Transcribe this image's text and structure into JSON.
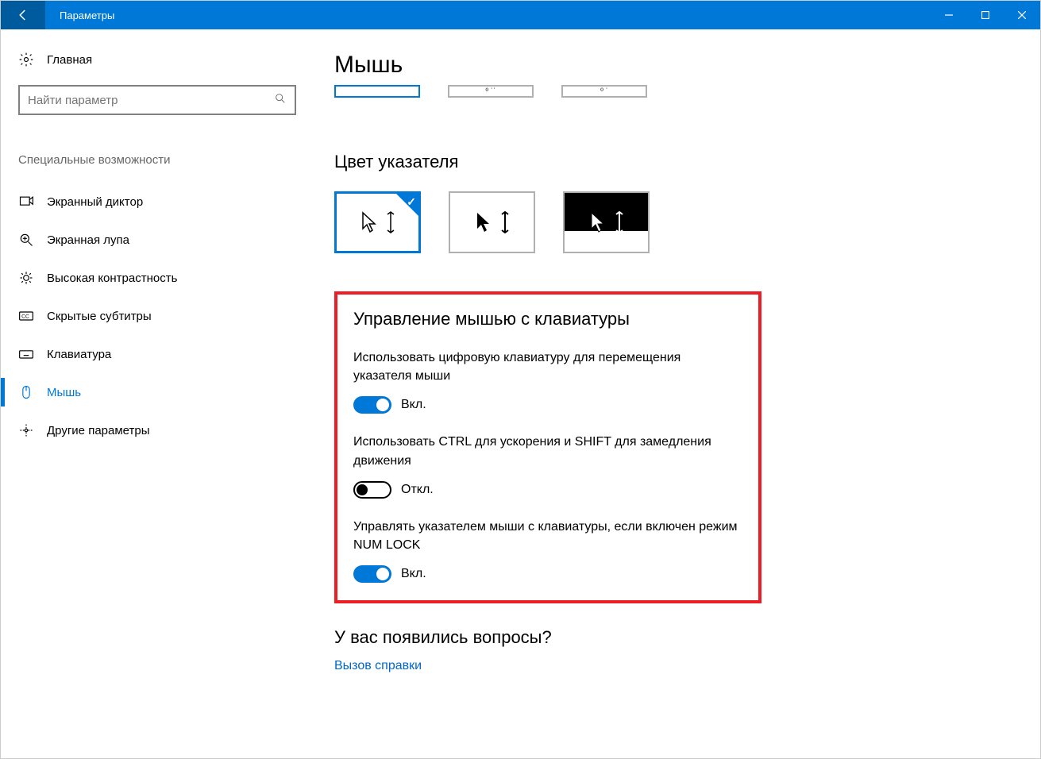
{
  "titlebar": {
    "title": "Параметры"
  },
  "sidebar": {
    "home": "Главная",
    "search_placeholder": "Найти параметр",
    "section": "Специальные возможности",
    "items": [
      {
        "icon": "narrator",
        "label": "Экранный диктор"
      },
      {
        "icon": "magnifier",
        "label": "Экранная лупа"
      },
      {
        "icon": "contrast",
        "label": "Высокая контрастность"
      },
      {
        "icon": "cc",
        "label": "Скрытые субтитры"
      },
      {
        "icon": "keyboard",
        "label": "Клавиатура"
      },
      {
        "icon": "mouse",
        "label": "Мышь"
      },
      {
        "icon": "other",
        "label": "Другие параметры"
      }
    ]
  },
  "main": {
    "title": "Мышь",
    "color_section": "Цвет указателя",
    "keyboard_section": "Управление мышью с клавиатуры",
    "setting1": "Использовать цифровую клавиатуру для перемещения указателя мыши",
    "setting2": "Использовать CTRL для ускорения и SHIFT для замедления движения",
    "setting3": "Управлять указателем мыши с клавиатуры, если включен режим NUM LOCK",
    "on": "Вкл.",
    "off": "Откл.",
    "questions": "У вас появились вопросы?",
    "help_link": "Вызов справки"
  }
}
